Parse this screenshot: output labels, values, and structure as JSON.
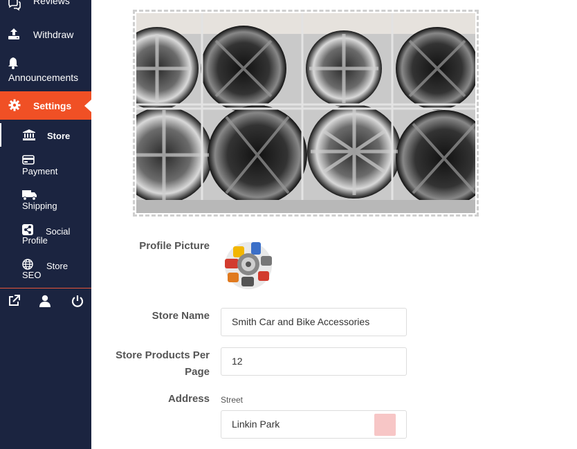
{
  "sidebar": {
    "items": [
      {
        "label": "Reviews",
        "icon": "comments-icon"
      },
      {
        "label": "Withdraw",
        "icon": "upload-icon"
      },
      {
        "label": "Announcements",
        "icon": "bell-icon"
      }
    ],
    "active": {
      "label": "Settings",
      "icon": "gear-icon"
    },
    "submenu": [
      {
        "label": "Store",
        "icon": "bank-icon"
      },
      {
        "label": "Payment",
        "icon": "credit-card-icon"
      },
      {
        "label": "Shipping",
        "icon": "truck-icon"
      },
      {
        "label_line1": "Social",
        "label_line2": "Profile",
        "icon": "share-icon"
      },
      {
        "label_line1": "Store",
        "label_line2": "SEO",
        "icon": "globe-icon"
      }
    ],
    "footer_icons": [
      "external-link-icon",
      "user-icon",
      "power-icon"
    ]
  },
  "form": {
    "profile_picture_label": "Profile Picture",
    "store_name_label": "Store Name",
    "store_name_value": "Smith Car and Bike Accessories",
    "per_page_label": "Store Products Per Page",
    "per_page_value": "12",
    "address_label": "Address",
    "street_label": "Street",
    "street_value": "Linkin Park"
  },
  "colors": {
    "sidebar_bg": "#1b2440",
    "accent": "#f05025"
  }
}
